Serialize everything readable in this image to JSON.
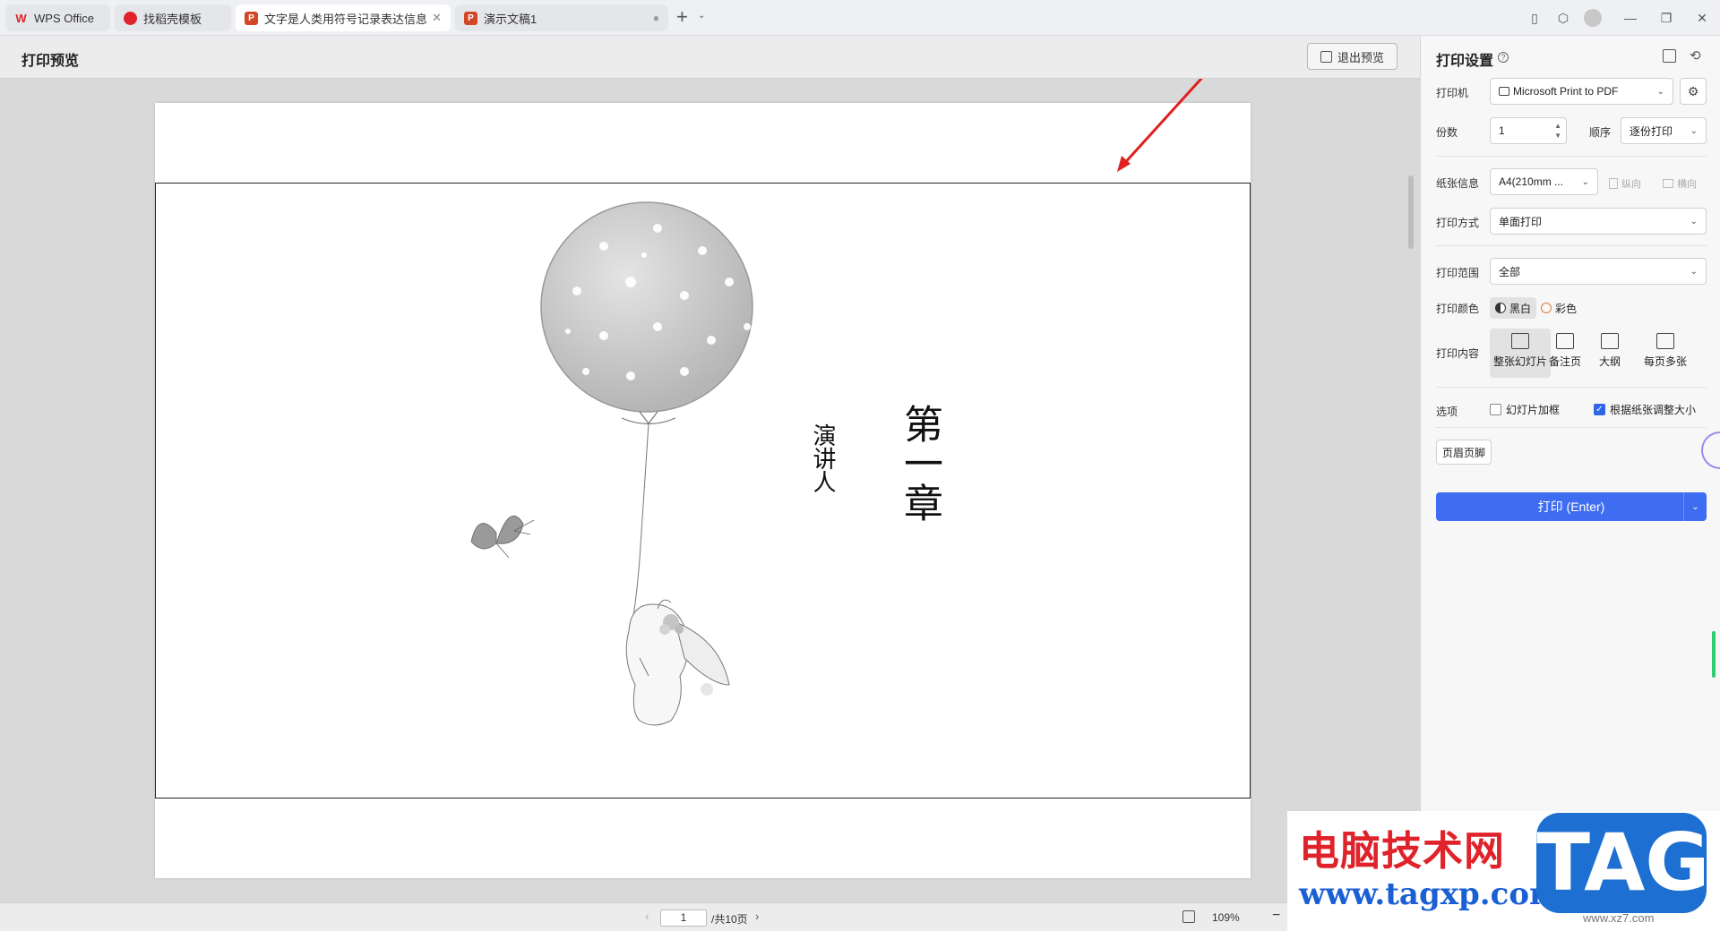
{
  "tabs": [
    {
      "label": "WPS Office",
      "icon": "wps-logo-icon",
      "color": "#e0232b"
    },
    {
      "label": "找稻壳模板",
      "icon": "docer-icon",
      "color": "#e0232b"
    },
    {
      "label": "文字是人类用符号记录表达信息以",
      "icon": "ppt-icon",
      "color": "#d24726"
    },
    {
      "label": "演示文稿1",
      "icon": "ppt-icon",
      "color": "#d24726"
    }
  ],
  "tab_icon_letter": "P",
  "preview": {
    "title": "打印预览",
    "exit_label": "退出预览"
  },
  "slide": {
    "title": "第一章",
    "speaker": "演讲人"
  },
  "pager": {
    "current_page": "1",
    "total_label": "/共10页"
  },
  "zoom": {
    "level_label": "109%",
    "fraction": 0.4
  },
  "settings": {
    "title": "打印设置",
    "printer_label": "打印机",
    "printer_value": "Microsoft Print to PDF",
    "copies_label": "份数",
    "copies_value": "1",
    "order_label": "顺序",
    "order_value": "逐份打印",
    "paper_label": "纸张信息",
    "paper_value": "A4(210mm ...",
    "portrait_label": "纵向",
    "landscape_label": "横向",
    "mode_label": "打印方式",
    "mode_value": "单面打印",
    "range_label": "打印范围",
    "range_value": "全部",
    "color_label": "打印颜色",
    "color_bw": "黑白",
    "color_color": "彩色",
    "content_label": "打印内容",
    "content_options": [
      "整张幻灯片",
      "备注页",
      "大纲",
      "每页多张"
    ],
    "options_label": "选项",
    "frame_label": "幻灯片加框",
    "fit_label": "根据纸张调整大小",
    "header_footer": "页眉页脚",
    "print_label": "打印 (Enter)",
    "accent_color": "#3f6df2"
  },
  "watermark": {
    "title": "电脑技术网",
    "url": "www.tagxp.com",
    "badge": "TAG",
    "small": "www.xz7.com"
  }
}
